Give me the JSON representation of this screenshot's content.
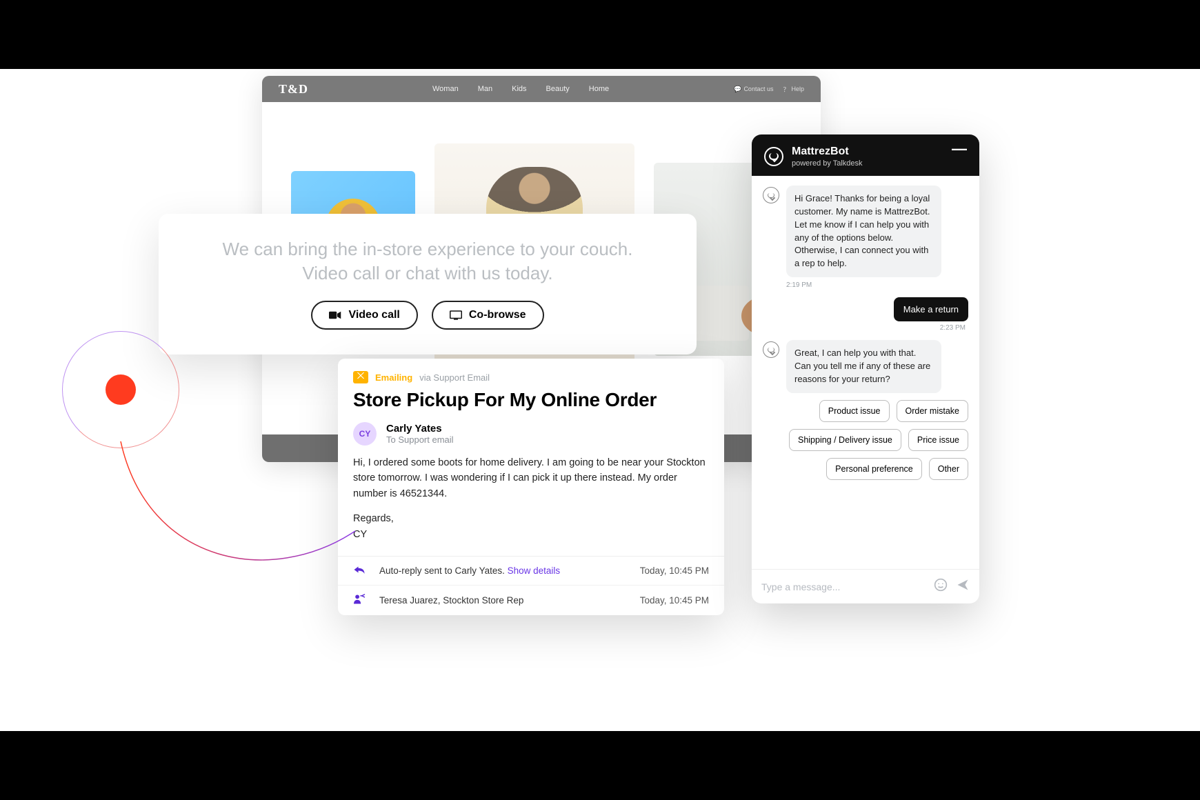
{
  "ecom": {
    "logo": "T&D",
    "nav": [
      "Woman",
      "Man",
      "Kids",
      "Beauty",
      "Home"
    ],
    "utils": {
      "contact": "Contact us",
      "help": "Help"
    }
  },
  "promo": {
    "line1": "We can bring the in-store experience to your couch.",
    "line2": "Video call or chat with us today.",
    "video_call": "Video call",
    "cobrowse": "Co-browse"
  },
  "email": {
    "emailing_label": "Emailing",
    "via_label": "via Support Email",
    "subject": "Store Pickup For My Online Order",
    "avatar_initials": "CY",
    "sender_name": "Carly Yates",
    "sender_to": "To Support email",
    "body_p1": "Hi,  I ordered some boots for home delivery. I am going to be near your Stockton store tomorrow. I was wondering if I can pick it up there instead. My order number is 46521344.",
    "body_regards": "Regards,",
    "body_sig": "CY",
    "log": {
      "row1_text": "Auto-reply sent to Carly Yates.",
      "row1_link": "Show details",
      "row1_time": "Today, 10:45 PM",
      "row2_text": "Teresa Juarez, Stockton Store Rep",
      "row2_time": "Today, 10:45 PM"
    }
  },
  "chat": {
    "title": "MattrezBot",
    "subtitle": "powered by Talkdesk",
    "msg1": "Hi Grace! Thanks for being a loyal customer. My name is MattrezBot. Let me know if I can help you with any of the options below. Otherwise, I can connect you with a rep to help.",
    "ts1": "2:19 PM",
    "user_msg": "Make a return",
    "ts2": "2:23 PM",
    "msg2": "Great, I can help you with that. Can you tell me if any of these are reasons for your return?",
    "chips": [
      "Product issue",
      "Order mistake",
      "Shipping / Delivery issue",
      "Price issue",
      "Personal preference",
      "Other"
    ],
    "placeholder": "Type a message..."
  }
}
